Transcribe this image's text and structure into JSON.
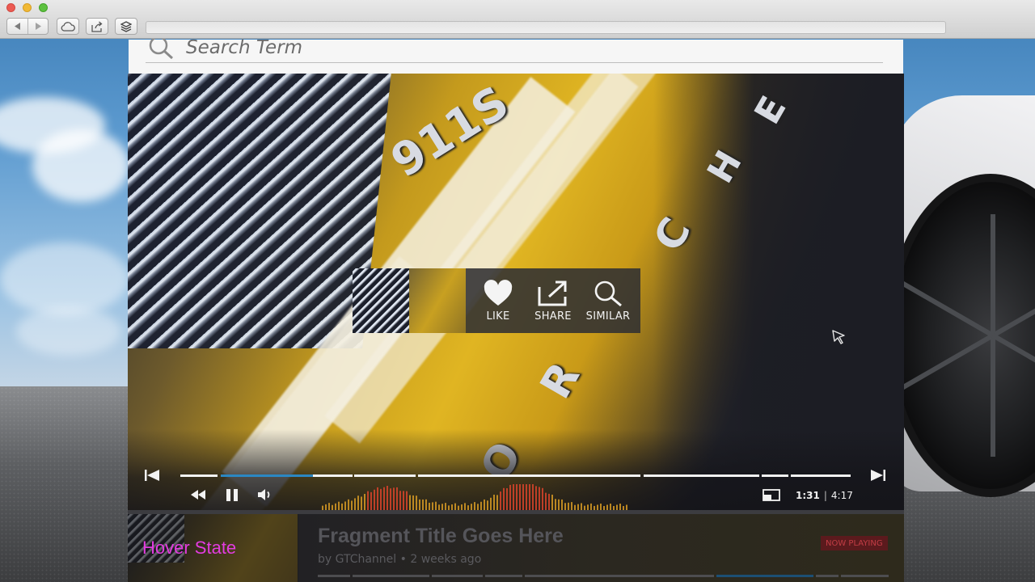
{
  "browser": {
    "nav_back_icon": "back-arrow-icon",
    "nav_forward_icon": "forward-arrow-icon",
    "toolbar_icons": [
      "cloud-icon",
      "share-icon",
      "layers-icon"
    ]
  },
  "search": {
    "placeholder": "Search Term",
    "icon": "search-icon"
  },
  "overlay": {
    "actions": [
      {
        "label": "LIKE",
        "icon": "heart-icon"
      },
      {
        "label": "SHARE",
        "icon": "share-out-icon"
      },
      {
        "label": "SIMILAR",
        "icon": "magnifier-icon"
      }
    ]
  },
  "player": {
    "progress_fraction": 0.198,
    "time_current": "1:31",
    "time_separator": "|",
    "time_total": "4:17",
    "accent_color": "#2b87c2",
    "controls": [
      "skip-previous-icon",
      "rewind-icon",
      "pause-icon",
      "volume-icon",
      "picture-in-picture-icon",
      "skip-next-icon"
    ]
  },
  "fragment": {
    "title": "Fragment Title Goes Here",
    "meta": "by GTChannel • 2 weeks ago",
    "badge": "NOW PLAYING",
    "badge_color": "#c23d45"
  },
  "annotation": {
    "label": "Hover State",
    "color": "#e33ce0"
  }
}
